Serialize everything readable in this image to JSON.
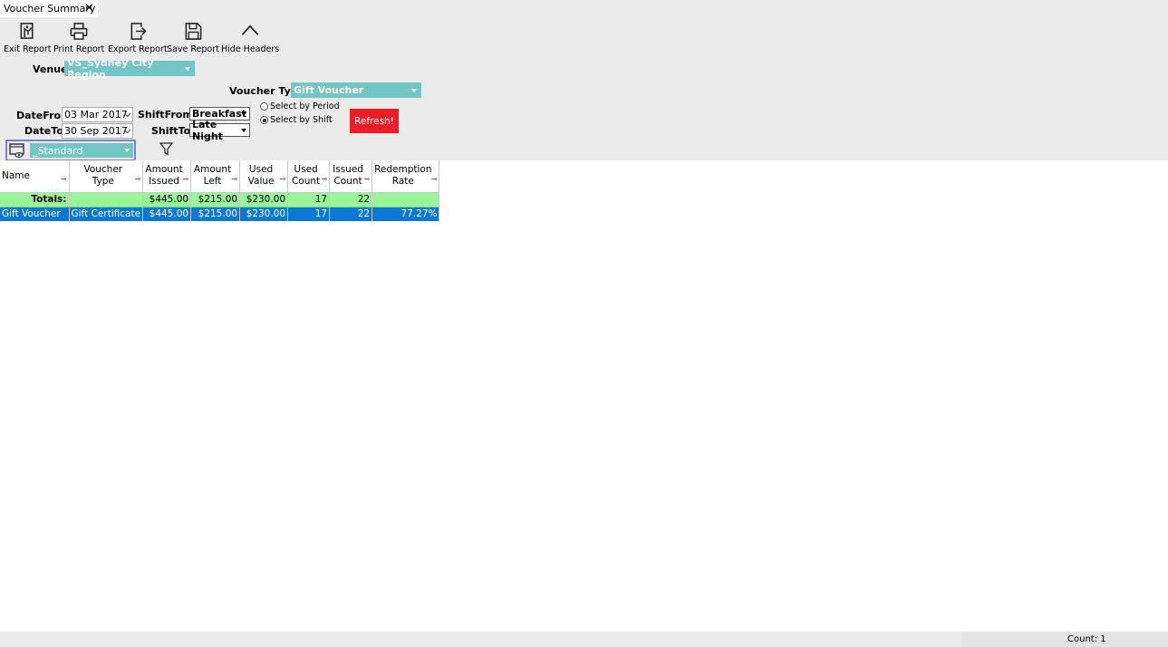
{
  "tab": {
    "title": "Voucher Summary",
    "close": "✕"
  },
  "toolbar": {
    "exit": "Exit Report",
    "print": "Print Report",
    "export": "Export Report",
    "save": "Save Report",
    "hide": "Hide Headers"
  },
  "filters": {
    "venue_label": "Venue:",
    "venue_value": "VS_Sydney City Region",
    "voucher_type_label": "Voucher Type:",
    "voucher_type_value": "Gift Voucher",
    "date_from_label": "DateFrom:",
    "date_from_value": "03 Mar 2017",
    "date_to_label": "DateTo:",
    "date_to_value": "30 Sep 2017",
    "shift_from_label": "ShiftFrom:",
    "shift_from_value": "Breakfast",
    "shift_to_label": "ShiftTo:",
    "shift_to_value": "Late Night",
    "radio_period": "Select by Period",
    "radio_shift": "Select by Shift",
    "refresh": "Refresh!",
    "layout_value": "_Standard"
  },
  "grid": {
    "headers": [
      {
        "line1": "Name",
        "line2": ""
      },
      {
        "line1": "Voucher",
        "line2": "Type"
      },
      {
        "line1": "Amount",
        "line2": "Issued"
      },
      {
        "line1": "Amount",
        "line2": "Left"
      },
      {
        "line1": "Used",
        "line2": "Value"
      },
      {
        "line1": "Used",
        "line2": "Count"
      },
      {
        "line1": "Issued",
        "line2": "Count"
      },
      {
        "line1": "Redemption",
        "line2": "Rate"
      }
    ],
    "pin": "⊸",
    "totals": {
      "label": "Totals:",
      "voucher_type": "",
      "amount_issued": "$445.00",
      "amount_left": "$215.00",
      "used_value": "$230.00",
      "used_count": "17",
      "issued_count": "22",
      "redemption_rate": ""
    },
    "rows": [
      {
        "name": "Gift Voucher",
        "voucher_type": "Gift Certificate",
        "amount_issued": "$445.00",
        "amount_left": "$215.00",
        "used_value": "$230.00",
        "used_count": "17",
        "issued_count": "22",
        "redemption_rate": "77.27%"
      }
    ]
  },
  "status": {
    "count": "Count: 1"
  }
}
